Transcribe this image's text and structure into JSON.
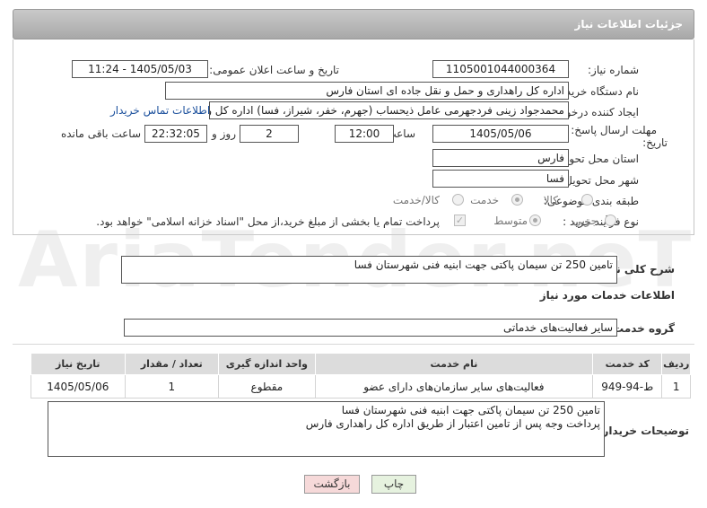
{
  "header": {
    "title": "جزئیات اطلاعات نیاز"
  },
  "fields": {
    "need_number_label": "شماره نیاز:",
    "need_number": "1105001044000364",
    "announce_label": "تاریخ و ساعت اعلان عمومی:",
    "announce_value": "1405/05/03 - 11:24",
    "buyer_org_label": "نام دستگاه خریدار:",
    "buyer_org": "اداره کل راهداری و حمل و نقل جاده ای استان فارس",
    "creator_label": "ایجاد کننده درخواست:",
    "creator": "محمدجواد زینی فردجهرمی عامل ذیحساب (جهرم، خفر، شیراز، فسا) اداره کل ر",
    "contact_link": "اطلاعات تماس خریدار",
    "deadline_label_1": "مهلت ارسال پاسخ: تا",
    "deadline_label_2": "تاریخ:",
    "deadline_date": "1405/05/06",
    "time_label": "ساعت",
    "deadline_time": "12:00",
    "days_value": "2",
    "days_label": "روز و",
    "remaining_time": "22:32:05",
    "remaining_label": "ساعت باقی مانده",
    "province_label": "استان محل تحویل:",
    "province": "فارس",
    "city_label": "شهر محل تحویل:",
    "city": "فسا",
    "category_label": "طبقه بندی موضوعی:",
    "category_options": [
      "کالا",
      "خدمت",
      "کالا/خدمت"
    ],
    "category_selected": "خدمت",
    "process_label": "نوع فرآیند خرید :",
    "process_options": [
      "جزیی",
      "متوسط"
    ],
    "process_selected": "متوسط",
    "payment_note": "پرداخت تمام یا بخشی از مبلغ خرید،از محل \"اسناد خزانه اسلامی\" خواهد بود."
  },
  "summary": {
    "label": "شرح کلی نیاز:",
    "value": "تامین 250 تن سیمان پاکتی جهت ابنیه فنی شهرستان فسا"
  },
  "services": {
    "section_title": "اطلاعات خدمات مورد نیاز",
    "group_label": "گروه خدمت:",
    "group_value": "سایر فعالیت‌های خدماتی"
  },
  "table": {
    "headers": [
      "ردیف",
      "کد خدمت",
      "نام خدمت",
      "واحد اندازه گیری",
      "تعداد / مقدار",
      "تاریخ نیاز"
    ],
    "rows": [
      [
        "1",
        "ط-94-949",
        "فعالیت‌های سایر سازمان‌های دارای عضو",
        "مقطوع",
        "1",
        "1405/05/06"
      ]
    ]
  },
  "buyer_notes": {
    "label": "توضیحات خریدار:",
    "line1": "تامین 250 تن سیمان پاکتی جهت ابنیه فنی شهرستان فسا",
    "line2": "پرداخت وجه پس از تامین اعتبار از طریق اداره کل راهداری فارس"
  },
  "buttons": {
    "print": "چاپ",
    "back": "بازگشت"
  },
  "watermark": "AriaTender.neT",
  "colors": {
    "link": "#1a4f9c",
    "header": "#b3b3b3",
    "back_button": "#f6d9d9",
    "print_button": "#e6f2df"
  }
}
